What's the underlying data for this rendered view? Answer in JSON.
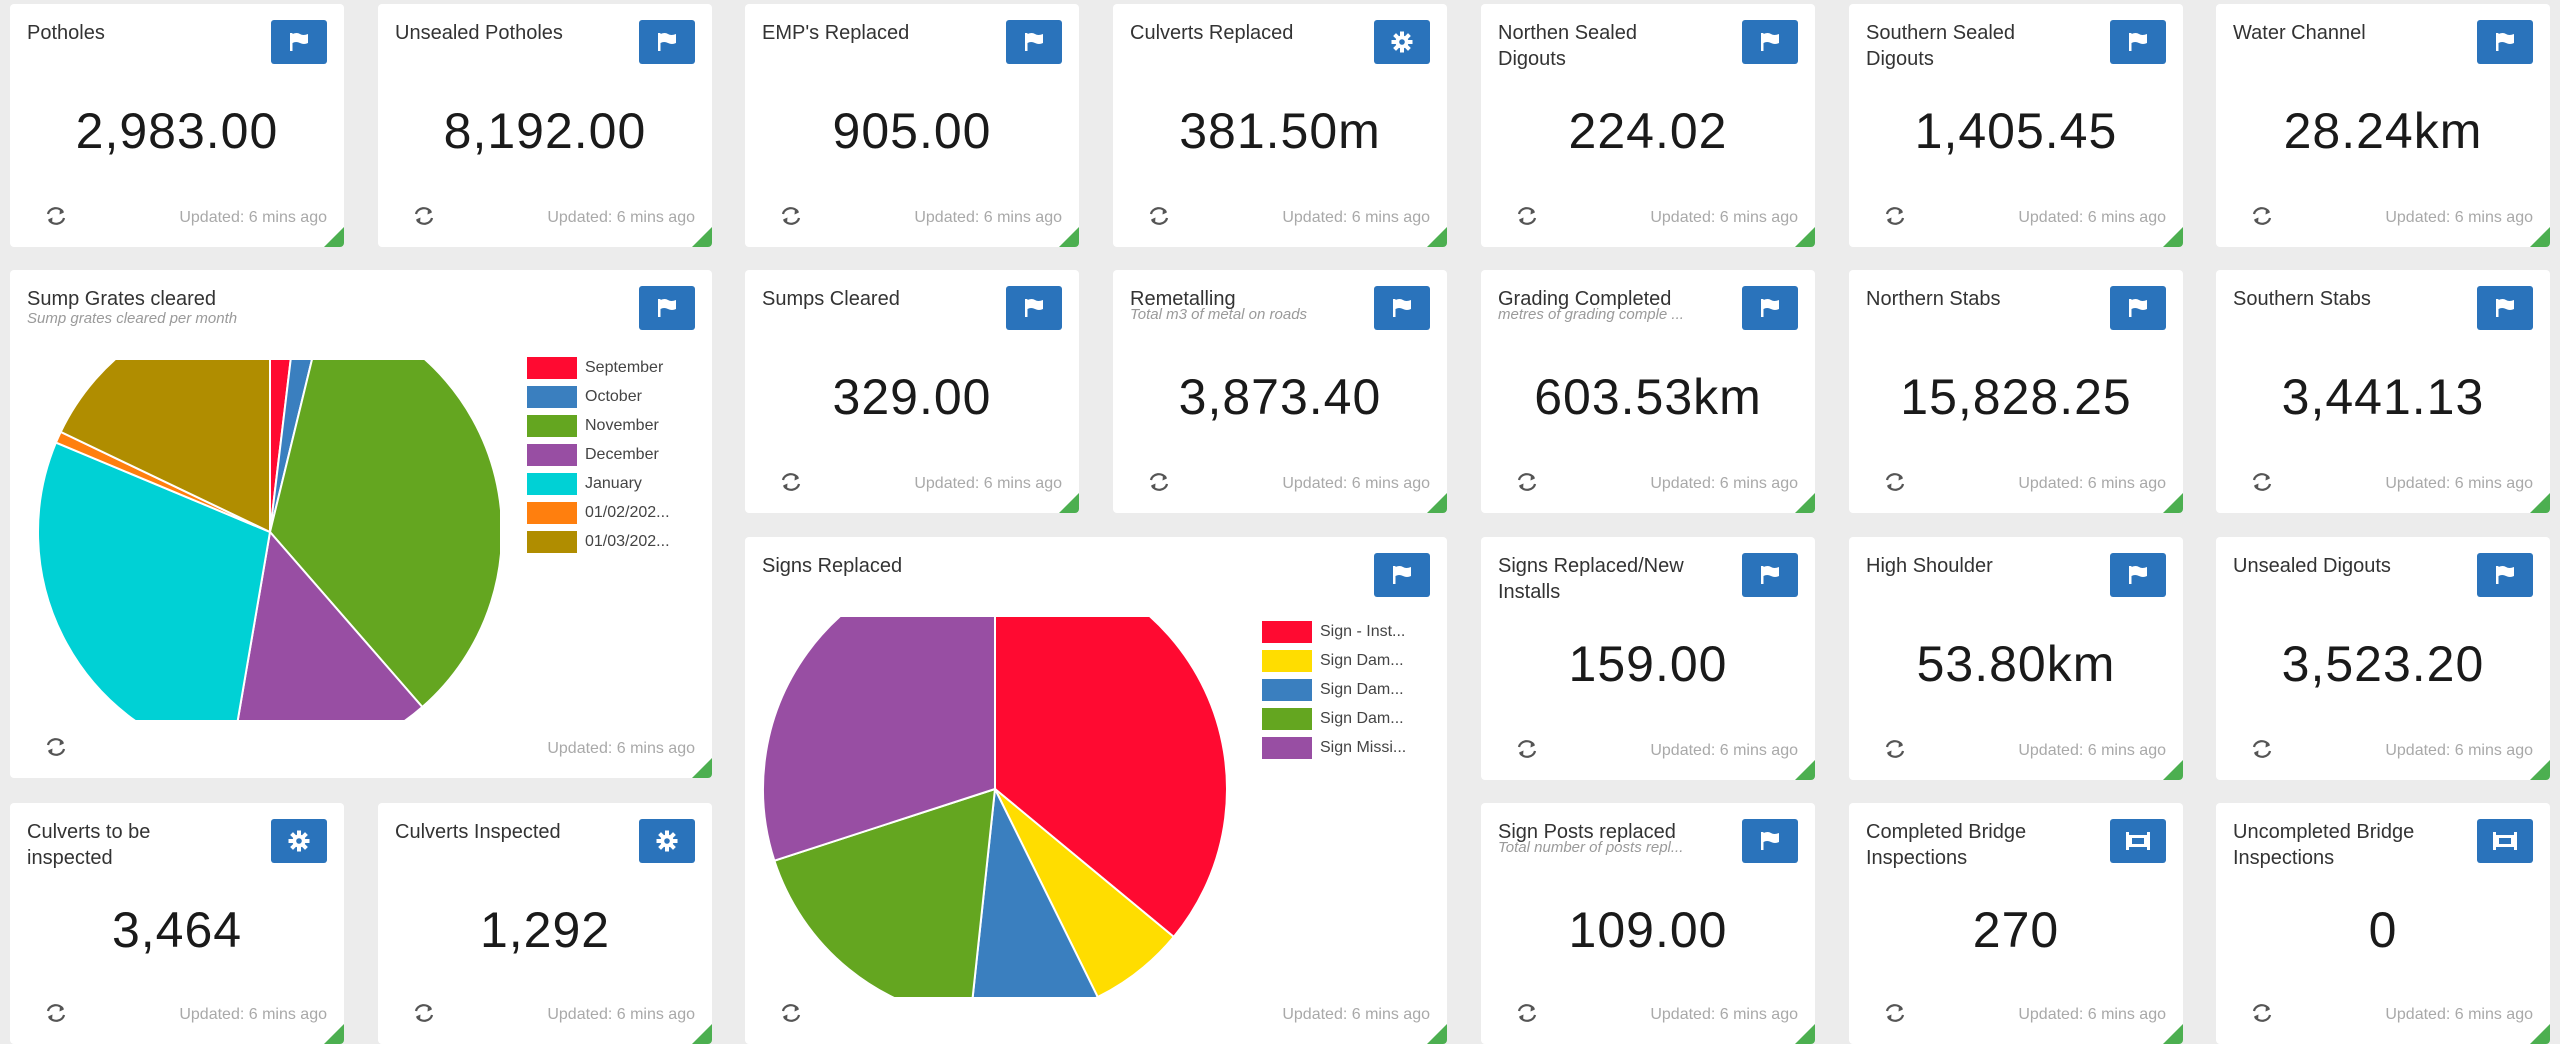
{
  "updated_text": "Updated: 6 mins ago",
  "colors": {
    "accent": "#2a73bb",
    "status_corner": "#4caf50",
    "background": "#ececec"
  },
  "tiles": {
    "potholes": {
      "title": "Potholes",
      "value": "2,983.00",
      "icon": "flag-icon"
    },
    "unsealed_potholes": {
      "title": "Unsealed Potholes",
      "value": "8,192.00",
      "icon": "flag-icon"
    },
    "emps_replaced": {
      "title": "EMP's Replaced",
      "value": "905.00",
      "icon": "flag-icon"
    },
    "culverts_replaced": {
      "title": "Culverts Replaced",
      "value": "381.50m",
      "icon": "gear-icon"
    },
    "northern_sealed_digouts": {
      "title": "Northen Sealed Digouts",
      "value": "224.02",
      "icon": "flag-icon"
    },
    "southern_sealed_digouts": {
      "title": "Southern Sealed Digouts",
      "value": "1,405.45",
      "icon": "flag-icon"
    },
    "water_channel": {
      "title": "Water Channel",
      "value": "28.24km",
      "icon": "flag-icon"
    },
    "sump_grates": {
      "title": "Sump Grates cleared",
      "subtitle": "Sump grates cleared per month",
      "icon": "flag-icon"
    },
    "sumps_cleared": {
      "title": "Sumps Cleared",
      "value": "329.00",
      "icon": "flag-icon"
    },
    "remetalling": {
      "title": "Remetalling",
      "subtitle": "Total m3 of metal on roads",
      "value": "3,873.40",
      "icon": "flag-icon"
    },
    "grading_completed": {
      "title": "Grading Completed",
      "subtitle": "metres of grading comple ...",
      "value": "603.53km",
      "icon": "flag-icon"
    },
    "northern_stabs": {
      "title": "Northern Stabs",
      "value": "15,828.25",
      "icon": "flag-icon"
    },
    "southern_stabs": {
      "title": "Southern Stabs",
      "value": "3,441.13",
      "icon": "flag-icon"
    },
    "signs_replaced": {
      "title": "Signs Replaced",
      "icon": "flag-icon"
    },
    "signs_replaced_new": {
      "title": "Signs Replaced/New Installs",
      "value": "159.00",
      "icon": "flag-icon"
    },
    "high_shoulder": {
      "title": "High Shoulder",
      "value": "53.80km",
      "icon": "flag-icon"
    },
    "unsealed_digouts": {
      "title": "Unsealed Digouts",
      "value": "3,523.20",
      "icon": "flag-icon"
    },
    "culverts_to_inspect": {
      "title": "Culverts to be inspected",
      "value": "3,464",
      "icon": "gear-icon"
    },
    "culverts_inspected": {
      "title": "Culverts Inspected",
      "value": "1,292",
      "icon": "gear-icon"
    },
    "sign_posts_replaced": {
      "title": "Sign Posts replaced",
      "subtitle": "Total number of posts repl...",
      "value": "109.00",
      "icon": "flag-icon"
    },
    "completed_bridge": {
      "title": "Completed Bridge Inspections",
      "value": "270",
      "icon": "bridge-icon"
    },
    "uncompleted_bridge": {
      "title": "Uncompleted Bridge Inspections",
      "value": "0",
      "icon": "bridge-icon"
    }
  },
  "chart_data": [
    {
      "type": "pie",
      "title": "Sump Grates cleared",
      "subtitle": "Sump grates cleared per month",
      "slices": [
        {
          "label": "September",
          "value": 1.9,
          "color": "#ff0a31"
        },
        {
          "label": "October",
          "value": 1.9,
          "color": "#3a7fbf"
        },
        {
          "label": "November",
          "value": 34.8,
          "color": "#64a620"
        },
        {
          "label": "December",
          "value": 14.1,
          "color": "#984ea3"
        },
        {
          "label": "January",
          "value": 28.6,
          "color": "#00d1d5"
        },
        {
          "label": "01/02/202...",
          "value": 0.8,
          "color": "#ff7f0e"
        },
        {
          "label": "01/03/202...",
          "value": 17.9,
          "color": "#b08d00"
        }
      ]
    },
    {
      "type": "pie",
      "title": "Signs Replaced",
      "slices": [
        {
          "label": "Sign - Inst...",
          "value": 36.0,
          "color": "#ff0a31"
        },
        {
          "label": "Sign Dam...",
          "value": 6.7,
          "color": "#ffdd00"
        },
        {
          "label": "Sign Dam...",
          "value": 9.0,
          "color": "#3a7fbf"
        },
        {
          "label": "Sign Dam...",
          "value": 18.3,
          "color": "#64a620"
        },
        {
          "label": "Sign Missi...",
          "value": 30.0,
          "color": "#984ea3"
        }
      ]
    }
  ]
}
